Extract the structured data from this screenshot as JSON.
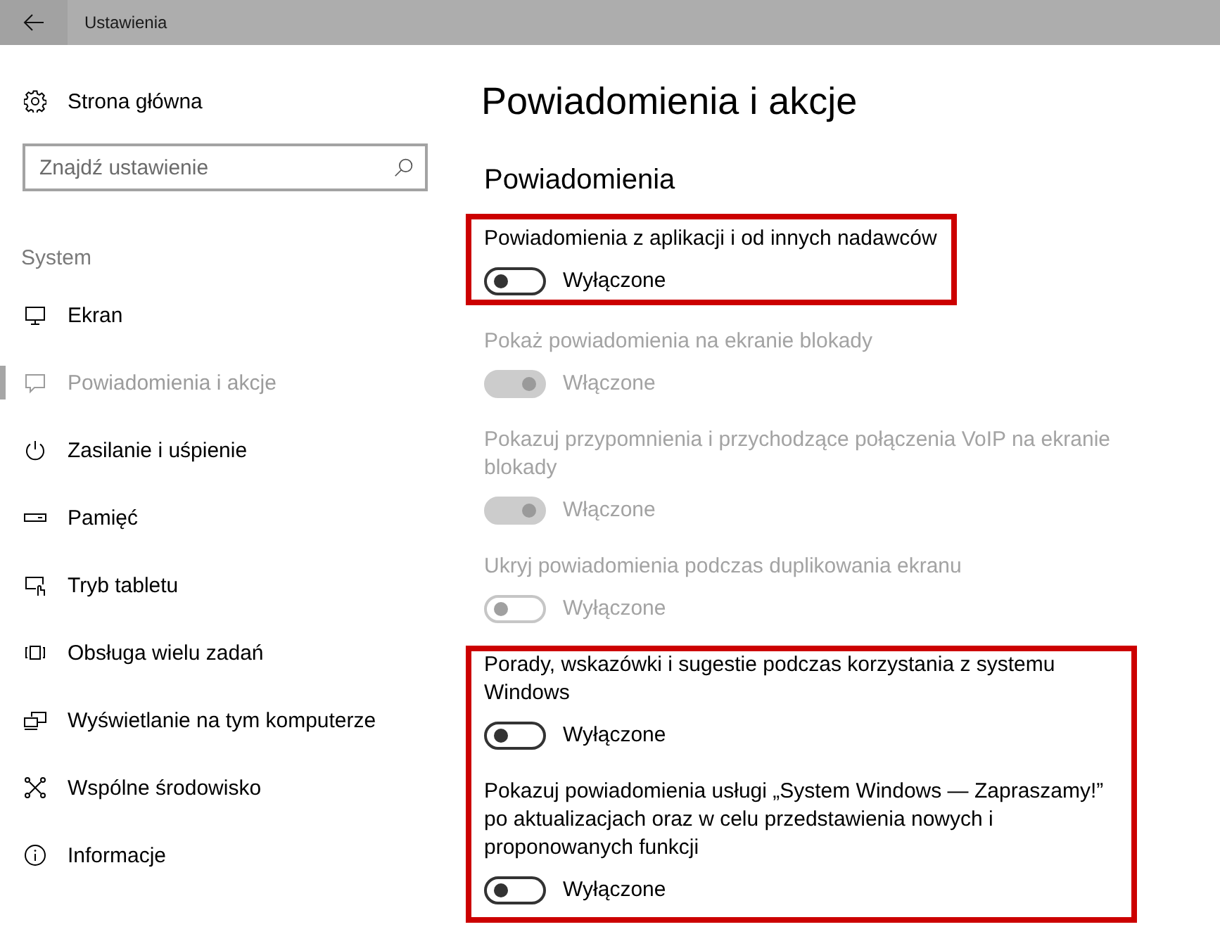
{
  "window": {
    "title": "Ustawienia"
  },
  "sidebar": {
    "home": "Strona główna",
    "search": {
      "placeholder": "Znajdź ustawienie"
    },
    "section": "System",
    "items": [
      {
        "label": "Ekran",
        "selected": false
      },
      {
        "label": "Powiadomienia i akcje",
        "selected": true
      },
      {
        "label": "Zasilanie i uśpienie",
        "selected": false
      },
      {
        "label": "Pamięć",
        "selected": false
      },
      {
        "label": "Tryb tabletu",
        "selected": false
      },
      {
        "label": "Obsługa wielu zadań",
        "selected": false
      },
      {
        "label": "Wyświetlanie na tym komputerze",
        "selected": false
      },
      {
        "label": "Wspólne środowisko",
        "selected": false
      },
      {
        "label": "Informacje",
        "selected": false
      }
    ]
  },
  "main": {
    "title": "Powiadomienia i akcje",
    "section": "Powiadomienia",
    "groups": [
      {
        "highlighted": true,
        "items": [
          {
            "label": "Powiadomienia z aplikacji i od innych nadawców",
            "on": false,
            "disabled": false,
            "state": "Wyłączone"
          }
        ]
      },
      {
        "highlighted": false,
        "items": [
          {
            "label": "Pokaż powiadomienia na ekranie blokady",
            "on": true,
            "disabled": true,
            "state": "Włączone"
          },
          {
            "label": "Pokazuj przypomnienia i przychodzące połączenia VoIP na ekranie blokady",
            "on": true,
            "disabled": true,
            "state": "Włączone"
          },
          {
            "label": "Ukryj powiadomienia podczas duplikowania ekranu",
            "on": false,
            "disabled": true,
            "state": "Wyłączone"
          }
        ]
      },
      {
        "highlighted": true,
        "items": [
          {
            "label": "Porady, wskazówki i sugestie podczas korzystania z systemu Windows",
            "on": false,
            "disabled": false,
            "state": "Wyłączone"
          },
          {
            "label": "Pokazuj powiadomienia usługi „System Windows — Zapraszamy!” po aktualizacjach oraz w celu przedstawienia nowych i proponowanych funkcji",
            "on": false,
            "disabled": false,
            "state": "Wyłączone"
          }
        ]
      }
    ]
  }
}
